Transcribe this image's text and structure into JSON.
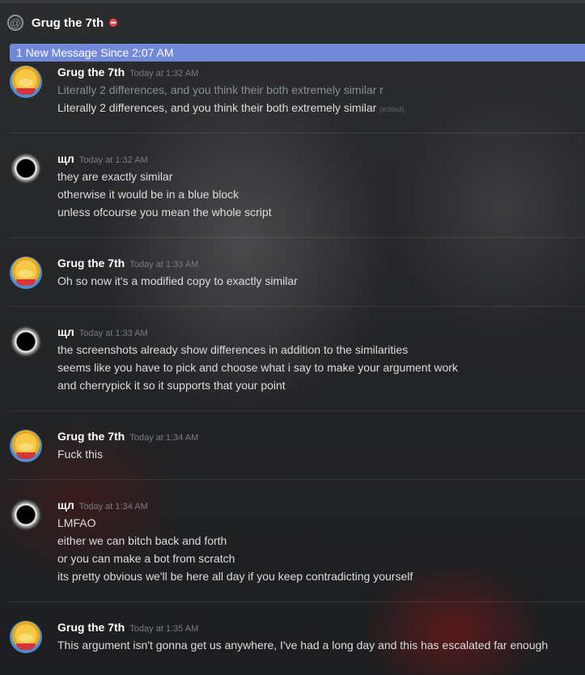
{
  "header": {
    "title": "Grug the 7th",
    "at_symbol": "@"
  },
  "new_messages_bar": "1 New Message Since 2:07 AM",
  "messages": [
    {
      "author": "Grug the 7th",
      "timestamp": "Today at 1:32 AM",
      "avatar": "winnie-pooh-avatar",
      "lines": [
        "Literally 2 differences, and you think their both extremely similar r",
        "Literally 2 differences, and you think their both extremely similar"
      ],
      "edited": "(edited)"
    },
    {
      "author": "щл",
      "timestamp": "Today at 1:32 AM",
      "avatar": "eclipse-avatar",
      "lines": [
        "they are exactly similar",
        "otherwise it would be in a blue block",
        "unless ofcourse you mean the whole script"
      ]
    },
    {
      "author": "Grug the 7th",
      "timestamp": "Today at 1:33 AM",
      "avatar": "winnie-pooh-avatar",
      "lines": [
        "Oh so now it's a modified copy to exactly similar"
      ]
    },
    {
      "author": "щл",
      "timestamp": "Today at 1:33 AM",
      "avatar": "eclipse-avatar",
      "lines": [
        "the screenshots already show differences in addition to the similarities",
        "seems like you have to pick and choose what i say to make your argument work",
        "and cherrypick it so it supports that your point"
      ]
    },
    {
      "author": "Grug the 7th",
      "timestamp": "Today at 1:34 AM",
      "avatar": "winnie-pooh-avatar",
      "lines": [
        "Fuck this"
      ]
    },
    {
      "author": "щл",
      "timestamp": "Today at 1:34 AM",
      "avatar": "eclipse-avatar",
      "lines": [
        "LMFAO",
        "either we can bitch back and forth",
        "or you can make a bot from scratch",
        "its pretty obvious we'll be here all day if you keep contradicting yourself"
      ]
    },
    {
      "author": "Grug the 7th",
      "timestamp": "Today at 1:35 AM",
      "avatar": "winnie-pooh-avatar",
      "lines": [
        "This argument isn't gonna get us anywhere, I've had a long day and this has escalated far enough"
      ]
    }
  ],
  "colors": {
    "accent": "#7289da",
    "dnd": "#f04747"
  }
}
